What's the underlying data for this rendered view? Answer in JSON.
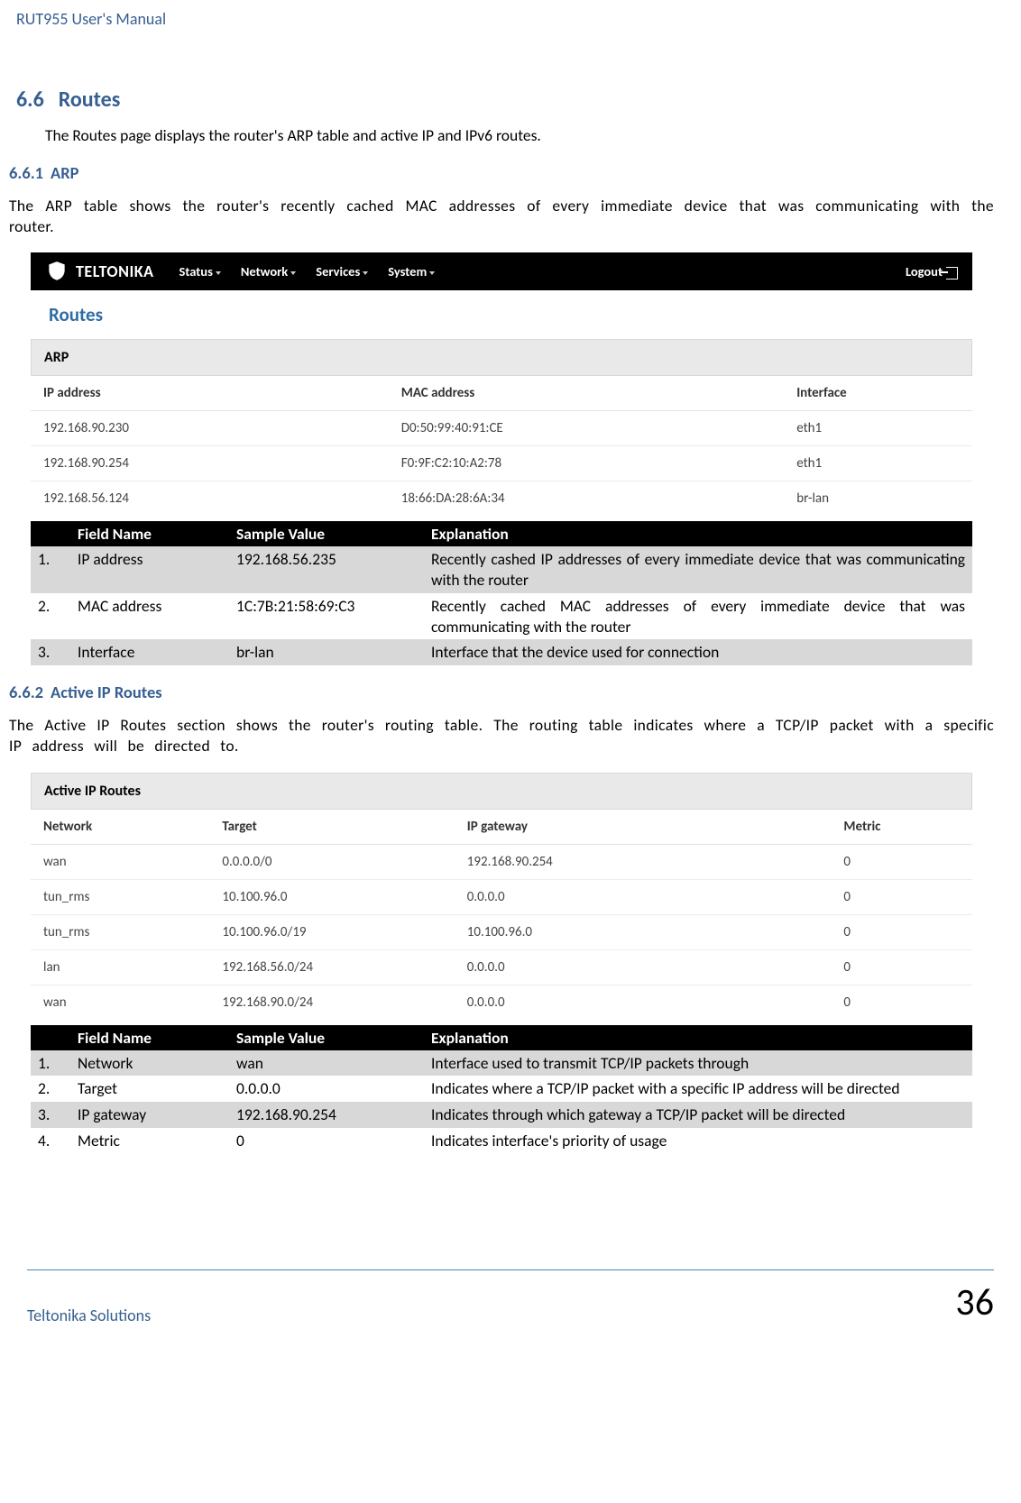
{
  "header": {
    "title": "RUT955 User's Manual"
  },
  "s66": {
    "num": "6.6",
    "title": "Routes",
    "intro": "The Routes page displays the router's ARP table and active IP and IPv6 routes."
  },
  "s661": {
    "num": "6.6.1",
    "title": "ARP",
    "text": "The ARP table shows the router's recently cached MAC addresses of every immediate device that was communicating with the router."
  },
  "ui": {
    "brand": "TELTONIKA",
    "menu": [
      "Status",
      "Network",
      "Services",
      "System"
    ],
    "logout": "Logout",
    "pageTitle": "Routes",
    "arp": {
      "panel": "ARP",
      "cols": [
        "IP address",
        "MAC address",
        "Interface"
      ],
      "rows": [
        {
          "ip": "192.168.90.230",
          "mac": "D0:50:99:40:91:CE",
          "if": "eth1"
        },
        {
          "ip": "192.168.90.254",
          "mac": "F0:9F:C2:10:A2:78",
          "if": "eth1"
        },
        {
          "ip": "192.168.56.124",
          "mac": "18:66:DA:28:6A:34",
          "if": "br-lan"
        }
      ]
    }
  },
  "arp_fields": {
    "head": [
      "Field Name",
      "Sample Value",
      "Explanation"
    ],
    "rows": [
      {
        "n": "1.",
        "name": "IP address",
        "val": "192.168.56.235",
        "exp": "Recently cashed IP addresses of every immediate device that was communicating with the router"
      },
      {
        "n": "2.",
        "name": "MAC address",
        "val": "1C:7B:21:58:69:C3",
        "exp": "Recently cached MAC addresses of every immediate device that was communicating with the router"
      },
      {
        "n": "3.",
        "name": "Interface",
        "val": "br-lan",
        "exp": "Interface that the device used for connection"
      }
    ]
  },
  "s662": {
    "num": "6.6.2",
    "title": "Active IP Routes",
    "text": "The Active IP Routes section shows the router's routing table. The routing table indicates where a TCP/IP packet with a specific IP address will be directed to."
  },
  "ui2": {
    "panel": "Active IP Routes",
    "cols": [
      "Network",
      "Target",
      "IP gateway",
      "Metric"
    ],
    "rows": [
      {
        "net": "wan",
        "t": "0.0.0.0/0",
        "gw": "192.168.90.254",
        "m": "0"
      },
      {
        "net": "tun_rms",
        "t": "10.100.96.0",
        "gw": "0.0.0.0",
        "m": "0"
      },
      {
        "net": "tun_rms",
        "t": "10.100.96.0/19",
        "gw": "10.100.96.0",
        "m": "0"
      },
      {
        "net": "lan",
        "t": "192.168.56.0/24",
        "gw": "0.0.0.0",
        "m": "0"
      },
      {
        "net": "wan",
        "t": "192.168.90.0/24",
        "gw": "0.0.0.0",
        "m": "0"
      }
    ]
  },
  "ip_fields": {
    "head": [
      "Field Name",
      "Sample Value",
      "Explanation"
    ],
    "rows": [
      {
        "n": "1.",
        "name": "Network",
        "val": "wan",
        "exp": "Interface used to transmit TCP/IP packets through"
      },
      {
        "n": "2.",
        "name": "Target",
        "val": "0.0.0.0",
        "exp": "Indicates where a TCP/IP packet with a specific IP address will be directed"
      },
      {
        "n": "3.",
        "name": "IP gateway",
        "val": "192.168.90.254",
        "exp": "Indicates through which gateway a TCP/IP packet will be directed"
      },
      {
        "n": "4.",
        "name": "Metric",
        "val": "0",
        "exp": "Indicates interface's priority of usage"
      }
    ]
  },
  "footer": {
    "left": "Teltonika Solutions",
    "page": "36"
  }
}
